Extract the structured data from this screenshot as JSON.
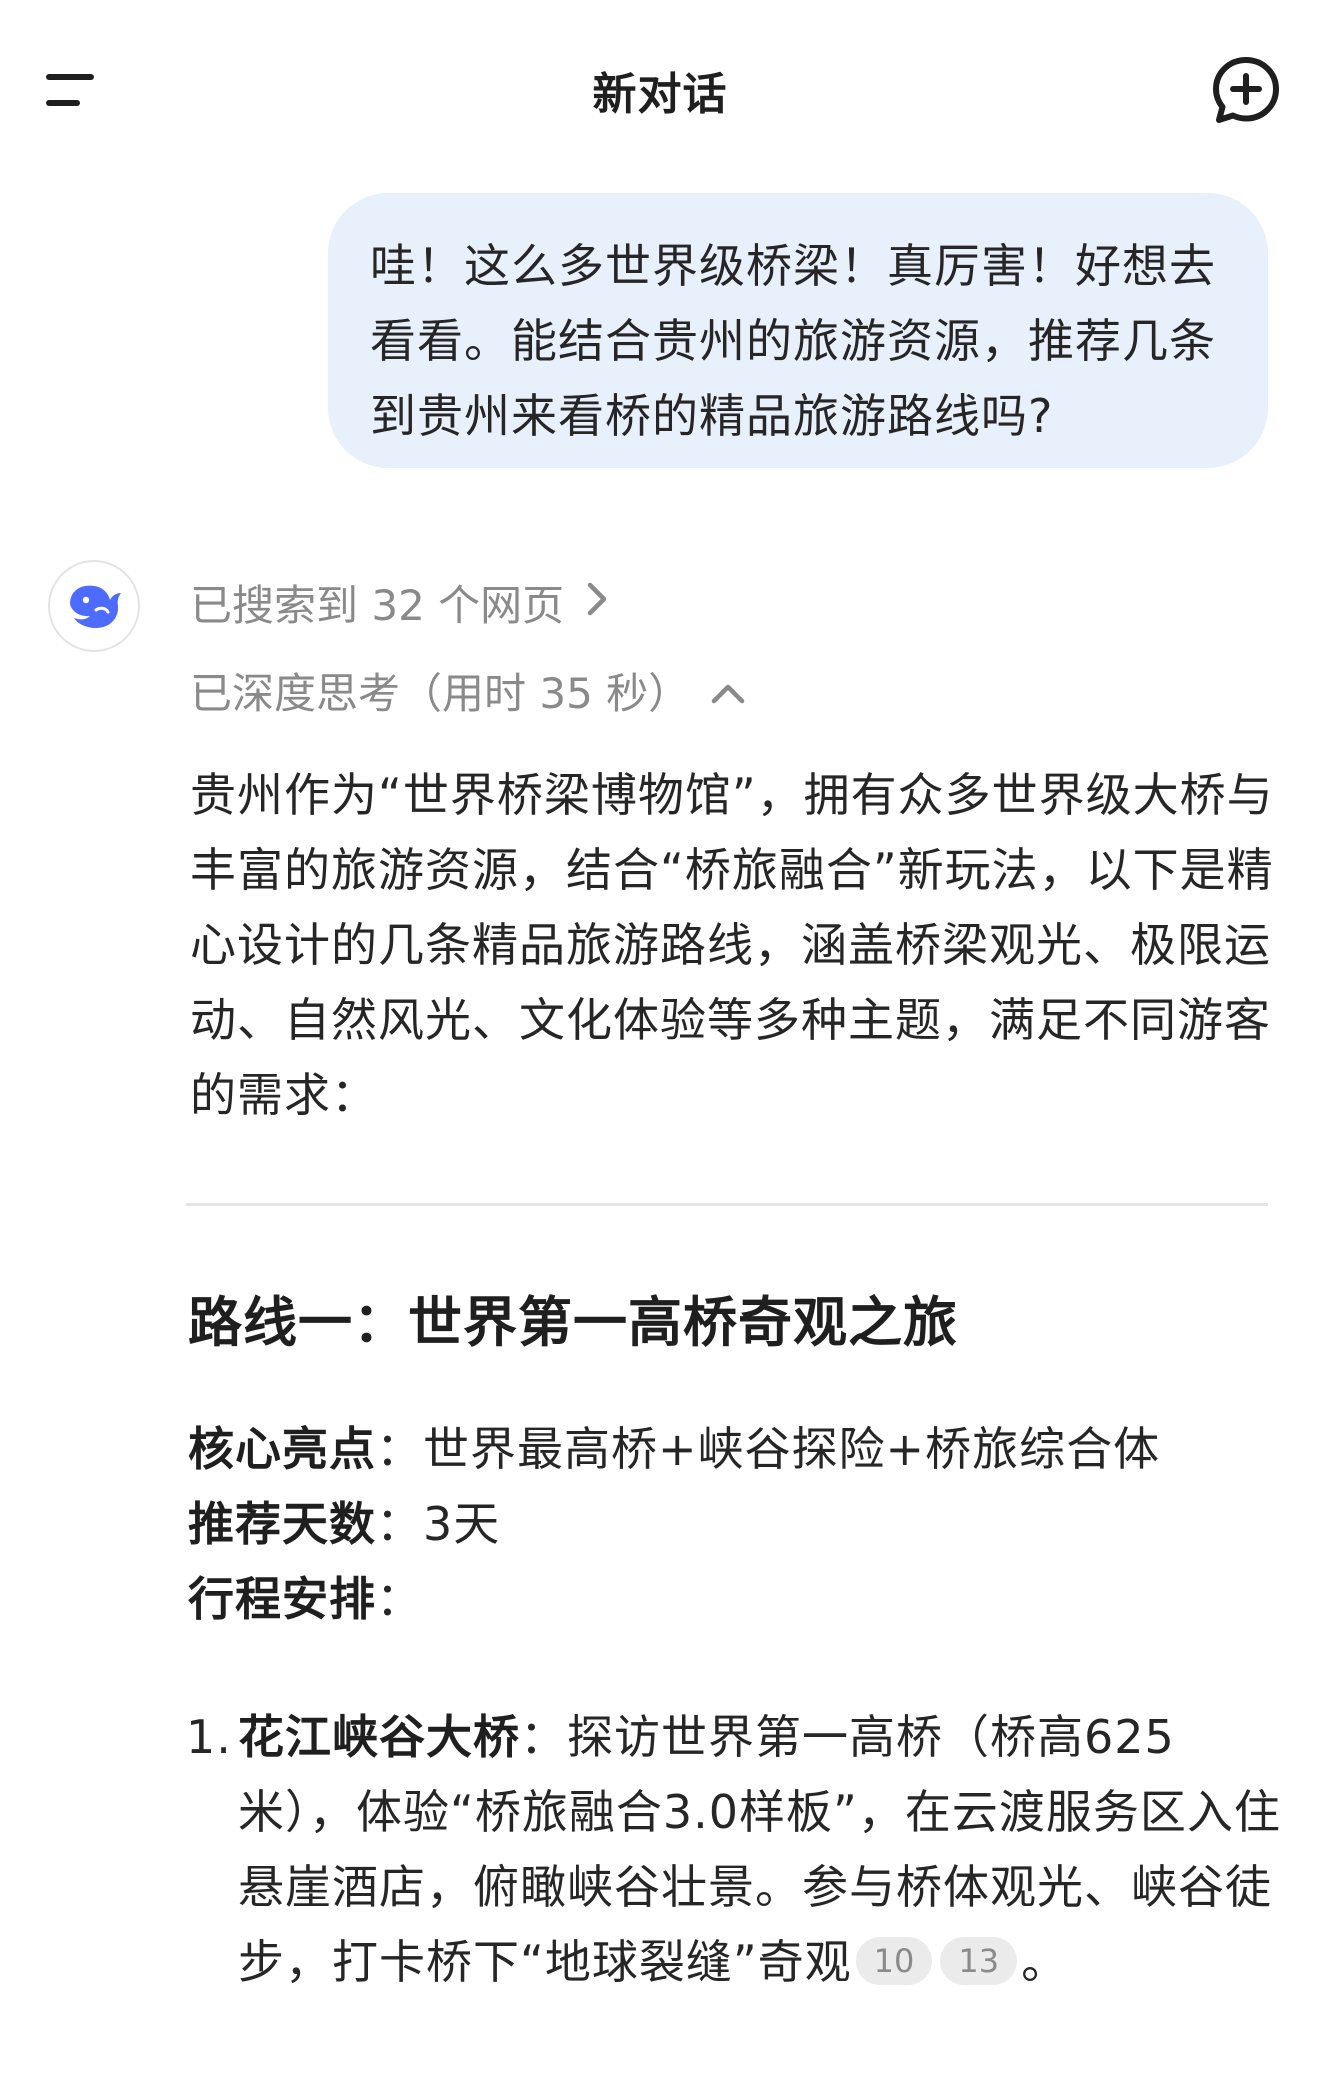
{
  "header": {
    "title": "新对话",
    "menu_icon": "menu-icon",
    "new_chat_icon": "new-chat-icon"
  },
  "user_message": {
    "text": "哇！这么多世界级桥梁！真厉害！好想去看看。能结合贵州的旅游资源，推荐几条到贵州来看桥的精品旅游路线吗?"
  },
  "assistant": {
    "avatar_icon": "whale-logo-icon",
    "search_status": "已搜索到 32 个网页",
    "think_status": "已深度思考（用时 35 秒）",
    "intro": "贵州作为“世界桥梁博物馆”，拥有众多世界级大桥与丰富的旅游资源，结合“桥旅融合”新玩法，以下是精心设计的几条精品旅游路线，涵盖桥梁观光、极限运动、自然风光、文化体验等多种主题，满足不同游客的需求：",
    "route1": {
      "title": "路线一：世界第一高桥奇观之旅",
      "highlights_label": "核心亮点",
      "highlights_value": "世界最高桥+峡谷探险+桥旅综合体",
      "days_label": "推荐天数",
      "days_value": "3天",
      "itinerary_label": "行程安排",
      "item1": {
        "number": "1.",
        "name": "花江峡谷大桥",
        "text": "：探访世界第一高桥（桥高625米），体验“桥旅融合3.0样板”，在云渡服务区入住悬崖酒店，俯瞰峡谷壮景。参与桥体观光、峡谷徒步，打卡桥下“地球裂缝”奇观",
        "cite1": "10",
        "cite2": "13",
        "end": "。"
      }
    }
  },
  "colors": {
    "bubble_bg": "#e8f0fc",
    "text": "#262626",
    "muted": "#8a8a8a",
    "brand_blue": "#4d6bfe"
  }
}
